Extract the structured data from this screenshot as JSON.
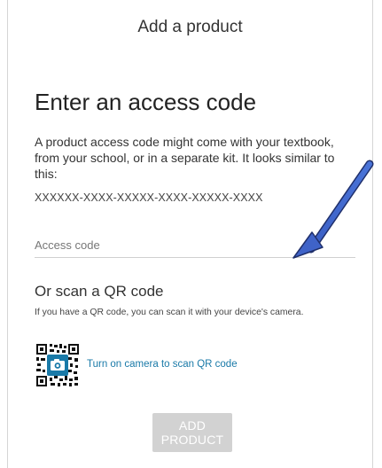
{
  "header": {
    "title": "Add a product"
  },
  "access_code": {
    "heading": "Enter an access code",
    "description": "A product access code might come with your textbook, from your school, or in a separate kit. It looks similar to this:",
    "sample": "XXXXXX-XXXX-XXXXX-XXXX-XXXXX-XXXX",
    "placeholder": "Access code"
  },
  "qr": {
    "heading": "Or scan a QR code",
    "description": "If you have a QR code, you can scan it with your device's camera.",
    "camera_link": "Turn on camera to scan QR code",
    "icon": "qr-camera-icon"
  },
  "actions": {
    "add_product": "ADD PRODUCT"
  },
  "colors": {
    "link": "#1a7aa8",
    "button_disabled": "#d2d2d2",
    "arrow": "#3f63c8"
  }
}
